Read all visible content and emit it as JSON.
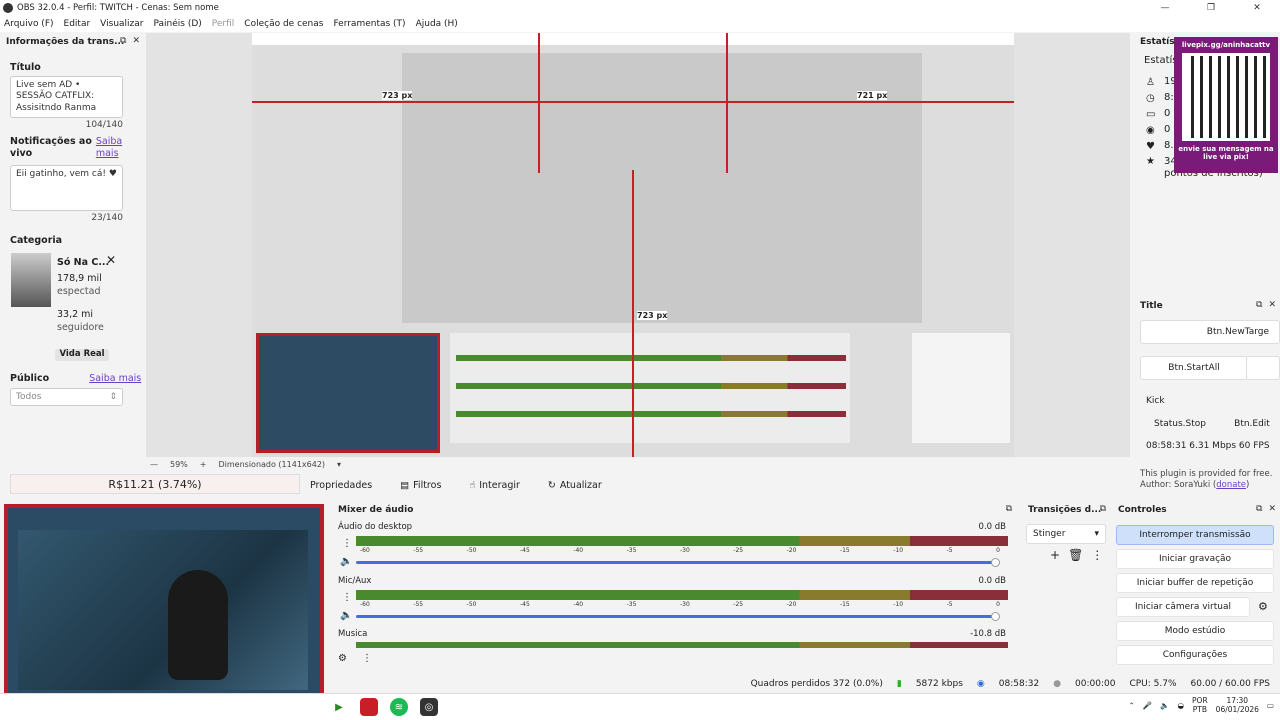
{
  "window": {
    "title": "OBS 32.0.4 - Perfil: TWITCH - Cenas: Sem nome"
  },
  "menu": [
    "Arquivo (F)",
    "Editar",
    "Visualizar",
    "Painéis (D)",
    "Perfil",
    "Coleção de cenas",
    "Ferramentas (T)",
    "Ajuda (H)"
  ],
  "info": {
    "header": "Informações da trans...",
    "title_label": "Título",
    "title_value": "Live sem AD • SESSÃO CATFLIX: Assisitndo Ranma",
    "title_count": "104/140",
    "notif_label": "Notificações ao",
    "notif_label2": "vivo",
    "notif_link": "Saiba mais",
    "notif_value": "Eii gatinho, vem cá! ♥",
    "notif_count": "23/140",
    "cat_label": "Categoria",
    "cat_name": "Só Na C...",
    "cat_viewers": "178,9 mil",
    "cat_viewers_label": "espectad",
    "cat_followers": "33,2 mi",
    "cat_followers_label": "seguidore",
    "cat_badge": "Vida Real",
    "public_label": "Público",
    "public_link": "Saiba mais",
    "public_value": "Todos"
  },
  "stats": {
    "header": "Estatísti",
    "sub": "Estatís",
    "rows": [
      "19",
      "8:5",
      "0 c",
      "0 v",
      "8.3",
      "34 inscritos (49 pontos de inscritos)"
    ]
  },
  "qr": {
    "top": "livepix.gg/aninhacattv",
    "bottom": "envie sua mensagem na live via pix!"
  },
  "titledock": {
    "header": "Title",
    "btn_newtarget": "Btn.NewTarge",
    "btn_startall": "Btn.StartAll",
    "kick": "Kick",
    "status_stop": "Status.Stop",
    "btn_edit": "Btn.Edit",
    "metrics": "08:58:31  6.31 Mbps  60 FPS",
    "plugin_note": "This plugin is provided for free. Author: SoraYuki (",
    "donate": "donate",
    "plugin_close": ")"
  },
  "toolbar": {
    "zoom": "59%",
    "dims": "Dimensionado (1141x642)"
  },
  "source": {
    "label": "R$11.21 (3.74%)"
  },
  "propbar": [
    "Propriedades",
    "Filtros",
    "Interagir",
    "Atualizar"
  ],
  "mixer": {
    "header": "Mixer de áudio",
    "ticks": [
      "-60",
      "-55",
      "-50",
      "-45",
      "-40",
      "-35",
      "-30",
      "-25",
      "-20",
      "-15",
      "-10",
      "-5",
      "0"
    ],
    "channels": [
      {
        "name": "Áudio do desktop",
        "db": "0.0 dB"
      },
      {
        "name": "Mic/Aux",
        "db": "0.0 dB"
      },
      {
        "name": "Musica",
        "db": "-10.8 dB"
      }
    ]
  },
  "transitions": {
    "header": "Transições d...",
    "value": "Stinger"
  },
  "controls": {
    "header": "Controles",
    "buttons": [
      "Interromper transmissão",
      "Iniciar gravação",
      "Iniciar buffer de repetição",
      "Iniciar câmera virtual",
      "Modo estúdio",
      "Configurações"
    ]
  },
  "status": {
    "frames": "Quadros perdidos 372 (0.0%)",
    "kbps": "5872 kbps",
    "stream_time": "08:58:32",
    "rec_time": "00:00:00",
    "cpu": "CPU: 5.7%",
    "fps": "60.00 / 60.00 FPS"
  },
  "tray": {
    "lang1": "POR",
    "lang2": "PTB",
    "time": "17:30",
    "date": "06/01/2026"
  },
  "overlay": {
    "measure_a": "723 px",
    "measure_b": "721 px"
  }
}
